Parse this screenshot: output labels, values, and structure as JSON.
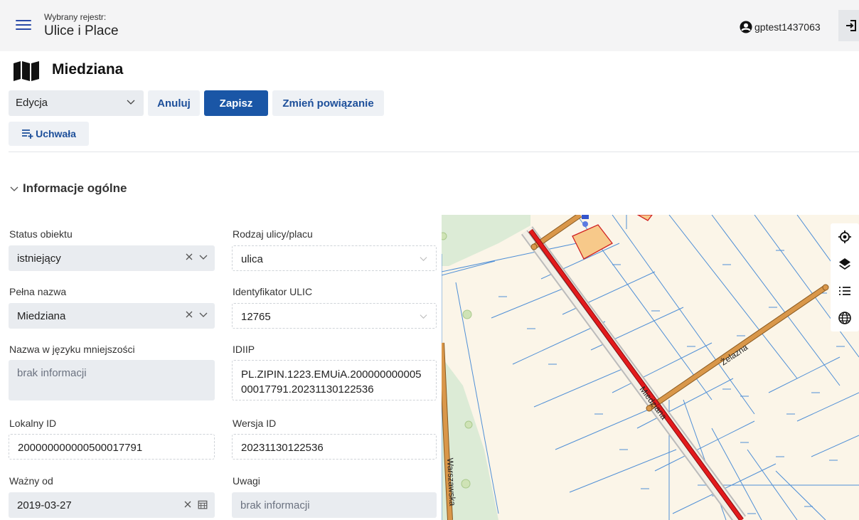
{
  "header": {
    "register_label": "Wybrany rejestr:",
    "register_name": "Ulice i Place",
    "username": "gptest1437063"
  },
  "page": {
    "title": "Miedziana",
    "title_icon": "map-icon"
  },
  "toolbar": {
    "mode_value": "Edycja",
    "cancel_label": "Anuluj",
    "save_label": "Zapisz",
    "change_link_label": "Zmień powiązanie",
    "resolution_label": "Uchwała"
  },
  "section": {
    "title": "Informacje ogólne"
  },
  "form": {
    "status": {
      "label": "Status obiektu",
      "value": "istniejący"
    },
    "street_type": {
      "label": "Rodzaj ulicy/placu",
      "value": "ulica"
    },
    "full_name": {
      "label": "Pełna nazwa",
      "value": "Miedziana"
    },
    "ulic_id": {
      "label": "Identyfikator ULIC",
      "value": "12765"
    },
    "minority_name": {
      "label": "Nazwa w języku mniejszości",
      "value": "brak informacji"
    },
    "idiip": {
      "label": "IDIIP",
      "value_line1": "PL.ZIPIN.1223.EMUiA.200000000005",
      "value_line2": "00017791.20231130122536"
    },
    "local_id": {
      "label": "Lokalny ID",
      "value": "200000000000500017791"
    },
    "version_id": {
      "label": "Wersja ID",
      "value": "20231130122536"
    },
    "valid_from": {
      "label": "Ważny od",
      "value": "2019-03-27"
    },
    "notes": {
      "label": "Uwagi",
      "value": "brak informacji"
    }
  },
  "map": {
    "street_labels": {
      "miedziana": "Miedziana",
      "zelazna": "Żelazna",
      "warszawska": "Warszawska"
    },
    "tools": [
      "locate-icon",
      "layers-icon",
      "legend-list-icon",
      "globe-icon"
    ],
    "colors": {
      "selected_street": "#e31a1c",
      "street": "#d9974a",
      "parcel_line": "#4f8fd6",
      "background": "#fbf5e8",
      "green": "#dcebd6"
    }
  }
}
